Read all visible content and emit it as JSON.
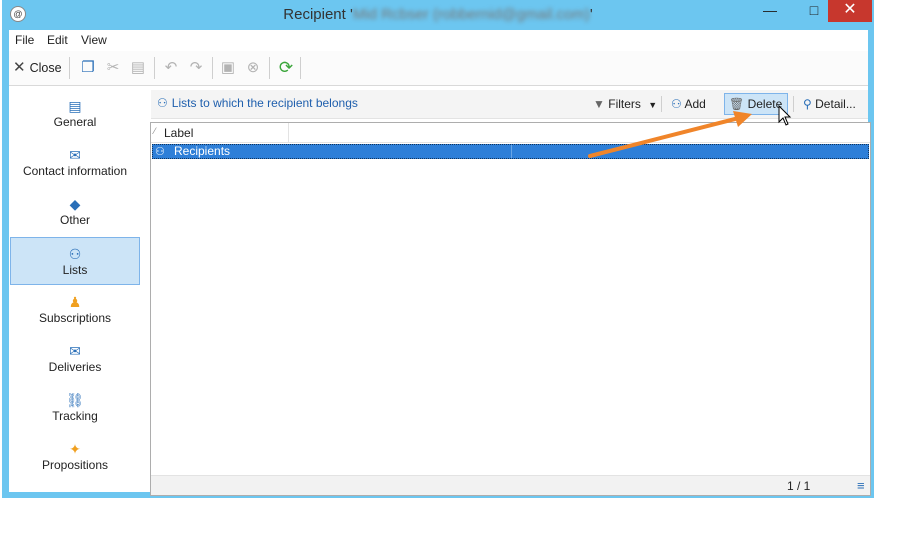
{
  "window": {
    "title_prefix": "Recipient '",
    "title_blurred": "Mid Rcbser (robbernid@gmail.com)",
    "title_suffix": "'",
    "minimize": "—",
    "maximize": "□",
    "close": "✕"
  },
  "menu": {
    "file": "File",
    "edit": "Edit",
    "view": "View"
  },
  "toolbar": {
    "close_label": "Close"
  },
  "sidebar": {
    "items": [
      {
        "label": "General",
        "icon": "clipboard-icon"
      },
      {
        "label": "Contact information",
        "icon": "contact-card-icon"
      },
      {
        "label": "Other",
        "icon": "cube-icon"
      },
      {
        "label": "Lists",
        "icon": "users-list-icon"
      },
      {
        "label": "Subscriptions",
        "icon": "person-icon"
      },
      {
        "label": "Deliveries",
        "icon": "envelope-icon"
      },
      {
        "label": "Tracking",
        "icon": "link-icon"
      },
      {
        "label": "Propositions",
        "icon": "gift-icon"
      }
    ],
    "active": "Lists"
  },
  "panel": {
    "title": "Lists to which the recipient belongs",
    "filters": "Filters",
    "add": "Add",
    "delete": "Delete",
    "detail": "Detail..."
  },
  "grid": {
    "column_label": "Label",
    "rows": [
      "Recipients"
    ],
    "pager": "1 / 1"
  },
  "colors": {
    "window_frame": "#6cc6f0",
    "selection": "#2e7fd8",
    "accent_arrow": "#f0852a",
    "link_blue": "#1f5fad"
  }
}
